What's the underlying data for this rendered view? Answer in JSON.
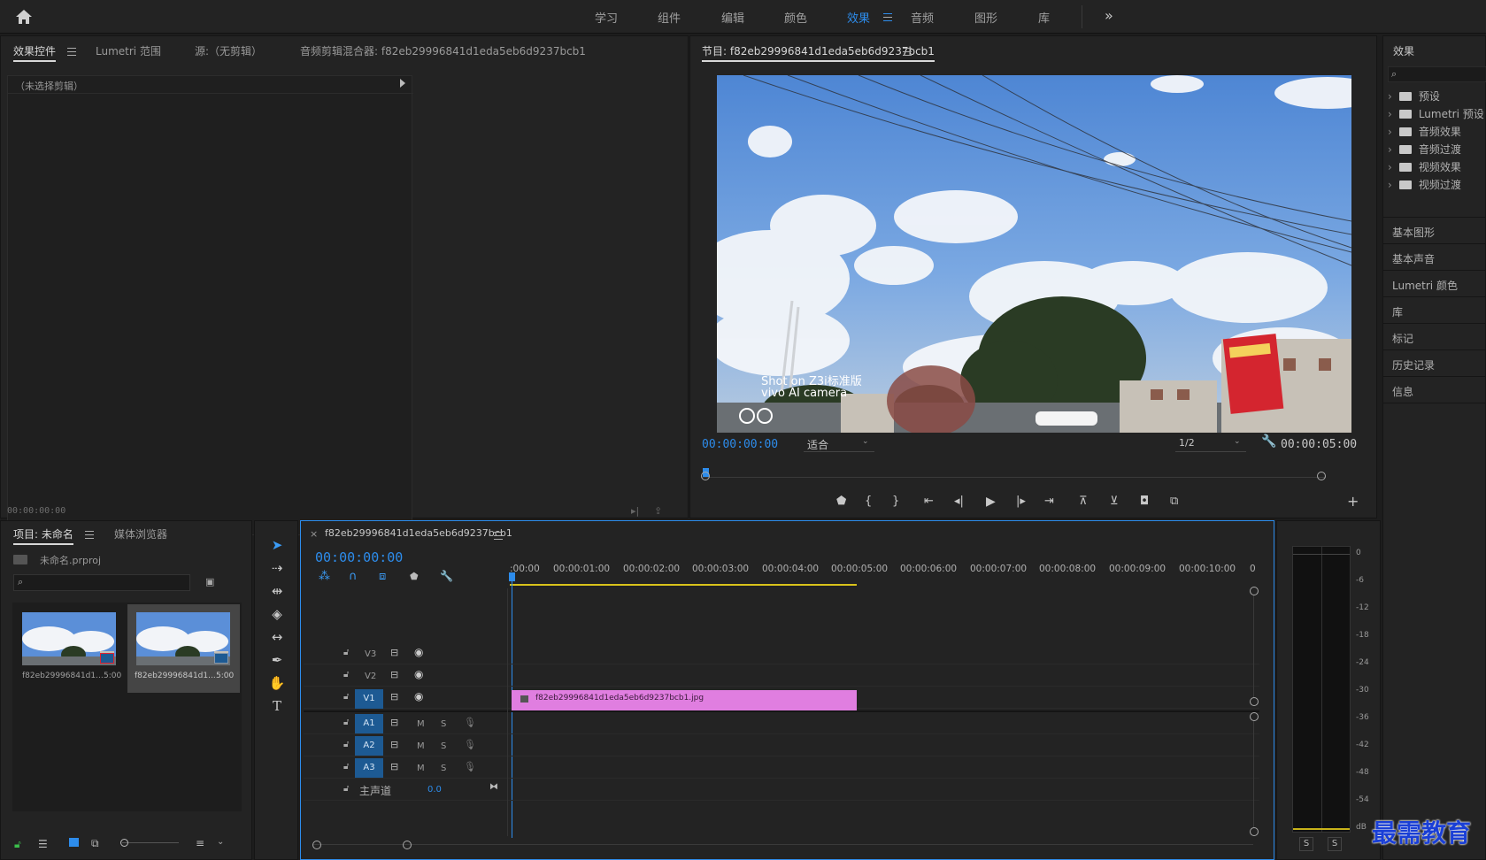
{
  "workspaces": [
    "学习",
    "组件",
    "编辑",
    "颜色",
    "效果",
    "音频",
    "图形",
    "库"
  ],
  "workspace_active": "效果",
  "source_panel": {
    "tabs": [
      "效果控件",
      "Lumetri 范围",
      "源:（无剪辑）",
      "音频剪辑混合器: f82eb29996841d1eda5eb6d9237bcb1"
    ],
    "no_clip": "（未选择剪辑）",
    "timecode": "00:00:00:00"
  },
  "program": {
    "title": "节目: f82eb29996841d1eda5eb6d9237bcb1",
    "overlay_line1": "Shot on Z3i标准版",
    "overlay_line2": "vivo AI camera",
    "timecode_current": "00:00:00:00",
    "zoom": "适合",
    "resolution": "1/2",
    "timecode_duration": "00:00:05:00"
  },
  "project": {
    "tabs": [
      "项目: 未命名",
      "媒体浏览器"
    ],
    "file": "未命名.prproj",
    "search_placeholder": "",
    "items": [
      {
        "name": "f82eb29996841d1...",
        "duration": "5:00"
      },
      {
        "name": "f82eb29996841d1...",
        "duration": "5:00"
      }
    ]
  },
  "timeline": {
    "sequence": "f82eb29996841d1eda5eb6d9237bcb1",
    "timecode": "00:00:00:00",
    "ruler": [
      ":00:00",
      "00:00:01:00",
      "00:00:02:00",
      "00:00:03:00",
      "00:00:04:00",
      "00:00:05:00",
      "00:00:06:00",
      "00:00:07:00",
      "00:00:08:00",
      "00:00:09:00",
      "00:00:10:00",
      "0"
    ],
    "video_tracks": [
      "V3",
      "V2",
      "V1"
    ],
    "audio_tracks": [
      "A1",
      "A2",
      "A3"
    ],
    "track_m": "M",
    "track_s": "S",
    "master": "主声道",
    "master_value": "0.0",
    "clip_name": "f82eb29996841d1eda5eb6d9237bcb1.jpg"
  },
  "effects": {
    "title": "效果",
    "tree": [
      "预设",
      "Lumetri 预设",
      "音频效果",
      "音频过渡",
      "视频效果",
      "视频过渡"
    ],
    "panels": [
      "基本图形",
      "基本声音",
      "Lumetri 颜色",
      "库",
      "标记",
      "历史记录",
      "信息"
    ]
  },
  "meters": {
    "scale": [
      "0",
      "-6",
      "-12",
      "-18",
      "-24",
      "-30",
      "-36",
      "-42",
      "-48",
      "-54",
      "dB"
    ],
    "solo": [
      "S",
      "S"
    ]
  },
  "watermark": "最需教育",
  "colors": {
    "accent": "#2d8ceb",
    "clip": "#e07ee0",
    "track_blue": "#1d5a93"
  }
}
